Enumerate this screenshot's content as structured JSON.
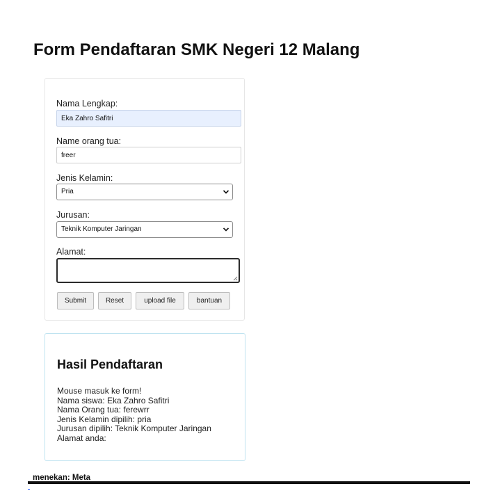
{
  "page": {
    "title": "Form Pendaftaran SMK Negeri 12 Malang"
  },
  "form": {
    "nama_label": "Nama Lengkap:",
    "nama_value": "Eka Zahro Safitri",
    "ortu_label": "Name orang tua:",
    "ortu_value": "freer",
    "gender_label": "Jenis Kelamin:",
    "gender_value": "Pria",
    "jurusan_label": "Jurusan:",
    "jurusan_value": "Teknik Komputer Jaringan",
    "alamat_label": "Alamat:",
    "alamat_value": "",
    "buttons": {
      "submit": "Submit",
      "reset": "Reset",
      "upload": "upload file",
      "help": "bantuan"
    }
  },
  "result": {
    "title": "Hasil Pendaftaran",
    "lines": [
      "Mouse masuk ke form!",
      "Nama siswa: Eka Zahro Safitri",
      "Nama Orang tua: ferewrr",
      "Jenis Kelamin dipilih: pria",
      "Jurusan dipilih: Teknik Komputer Jaringan",
      "Alamat anda:"
    ]
  },
  "status": {
    "text": "menekan: Meta"
  },
  "icons": {
    "select_arrow": "chevron-down-icon",
    "resize": "resize-grip-icon"
  }
}
